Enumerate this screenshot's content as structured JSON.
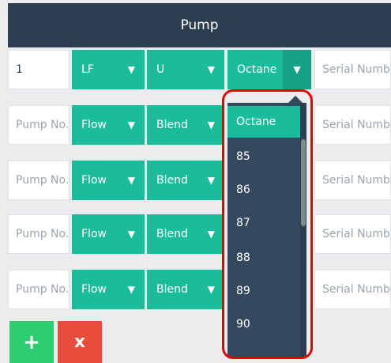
{
  "header": {
    "title": "Pump"
  },
  "first_row": {
    "pump_no_value": "1",
    "flow_value": "LF",
    "blend_value": "U",
    "octane_value": "Octane",
    "serial_placeholder": "Serial Number"
  },
  "empty_rows": [
    {
      "pump_no_placeholder": "Pump No.",
      "flow_value": "Flow",
      "blend_value": "Blend",
      "serial_placeholder": "Serial Number"
    },
    {
      "pump_no_placeholder": "Pump No.",
      "flow_value": "Flow",
      "blend_value": "Blend",
      "serial_placeholder": "Serial Number"
    },
    {
      "pump_no_placeholder": "Pump No.",
      "flow_value": "Flow",
      "blend_value": "Blend",
      "serial_placeholder": "Serial Number"
    },
    {
      "pump_no_placeholder": "Pump No.",
      "flow_value": "Flow",
      "blend_value": "Blend",
      "serial_placeholder": "Serial Number"
    }
  ],
  "octane_dropdown": {
    "options": [
      "Octane",
      "85",
      "86",
      "87",
      "88",
      "89",
      "90"
    ],
    "selected": "Octane"
  },
  "actions": {
    "add_label": "+",
    "remove_label": "x"
  },
  "icons": {
    "dropdown_arrow": "caret-down-icon"
  },
  "colors": {
    "header": "#2c3e50",
    "select": "#1abc9c",
    "dropdown": "#34495e",
    "add": "#2ecc71",
    "remove": "#e74c3c",
    "highlight": "#e60000"
  }
}
